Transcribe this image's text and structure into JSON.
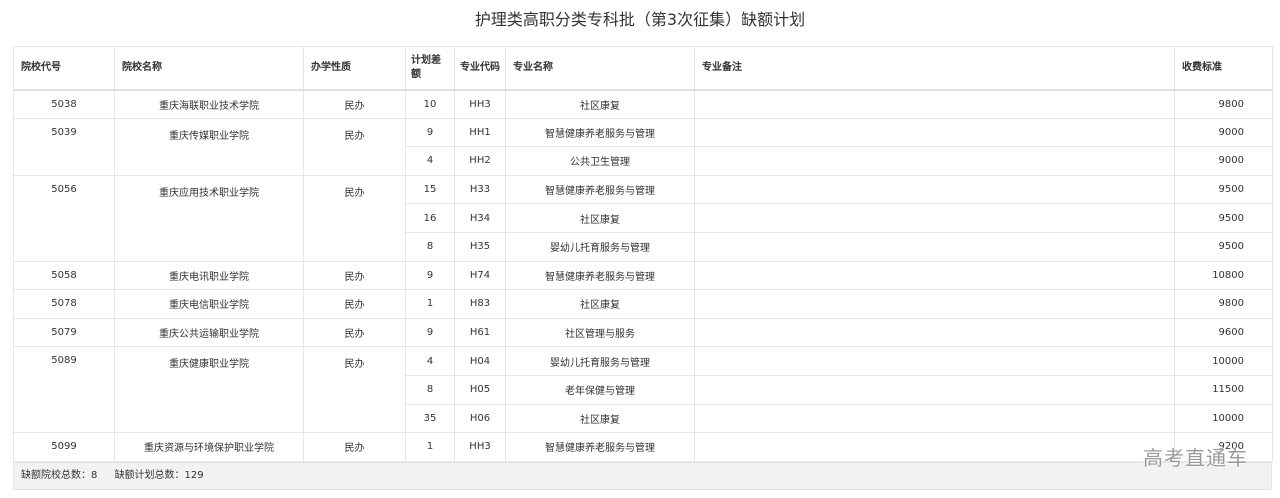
{
  "title": "护理类高职分类专科批（第3次征集）缺额计划",
  "columns": {
    "code": "院校代号",
    "name": "院校名称",
    "type": "办学性质",
    "gap": "计划差额",
    "major_code": "专业代码",
    "major_name": "专业名称",
    "note": "专业备注",
    "fee": "收费标准"
  },
  "schools": [
    {
      "code": "5038",
      "name": "重庆海联职业技术学院",
      "type": "民办",
      "majors": [
        {
          "gap": "10",
          "major_code": "HH3",
          "major_name": "社区康复",
          "note": "",
          "fee": "9800"
        }
      ]
    },
    {
      "code": "5039",
      "name": "重庆传媒职业学院",
      "type": "民办",
      "majors": [
        {
          "gap": "9",
          "major_code": "HH1",
          "major_name": "智慧健康养老服务与管理",
          "note": "",
          "fee": "9000"
        },
        {
          "gap": "4",
          "major_code": "HH2",
          "major_name": "公共卫生管理",
          "note": "",
          "fee": "9000"
        }
      ]
    },
    {
      "code": "5056",
      "name": "重庆应用技术职业学院",
      "type": "民办",
      "majors": [
        {
          "gap": "15",
          "major_code": "H33",
          "major_name": "智慧健康养老服务与管理",
          "note": "",
          "fee": "9500"
        },
        {
          "gap": "16",
          "major_code": "H34",
          "major_name": "社区康复",
          "note": "",
          "fee": "9500"
        },
        {
          "gap": "8",
          "major_code": "H35",
          "major_name": "婴幼儿托育服务与管理",
          "note": "",
          "fee": "9500"
        }
      ]
    },
    {
      "code": "5058",
      "name": "重庆电讯职业学院",
      "type": "民办",
      "majors": [
        {
          "gap": "9",
          "major_code": "H74",
          "major_name": "智慧健康养老服务与管理",
          "note": "",
          "fee": "10800"
        }
      ]
    },
    {
      "code": "5078",
      "name": "重庆电信职业学院",
      "type": "民办",
      "majors": [
        {
          "gap": "1",
          "major_code": "H83",
          "major_name": "社区康复",
          "note": "",
          "fee": "9800"
        }
      ]
    },
    {
      "code": "5079",
      "name": "重庆公共运输职业学院",
      "type": "民办",
      "majors": [
        {
          "gap": "9",
          "major_code": "H61",
          "major_name": "社区管理与服务",
          "note": "",
          "fee": "9600"
        }
      ]
    },
    {
      "code": "5089",
      "name": "重庆健康职业学院",
      "type": "民办",
      "majors": [
        {
          "gap": "4",
          "major_code": "H04",
          "major_name": "婴幼儿托育服务与管理",
          "note": "",
          "fee": "10000"
        },
        {
          "gap": "8",
          "major_code": "H05",
          "major_name": "老年保健与管理",
          "note": "",
          "fee": "11500"
        },
        {
          "gap": "35",
          "major_code": "H06",
          "major_name": "社区康复",
          "note": "",
          "fee": "10000"
        }
      ]
    },
    {
      "code": "5099",
      "name": "重庆资源与环境保护职业学院",
      "type": "民办",
      "majors": [
        {
          "gap": "1",
          "major_code": "HH3",
          "major_name": "智慧健康养老服务与管理",
          "note": "",
          "fee": "9200"
        }
      ]
    }
  ],
  "footer": {
    "school_total": "缺额院校总数：8",
    "plan_total": "缺额计划总数：129"
  },
  "watermark": "高考直通车"
}
